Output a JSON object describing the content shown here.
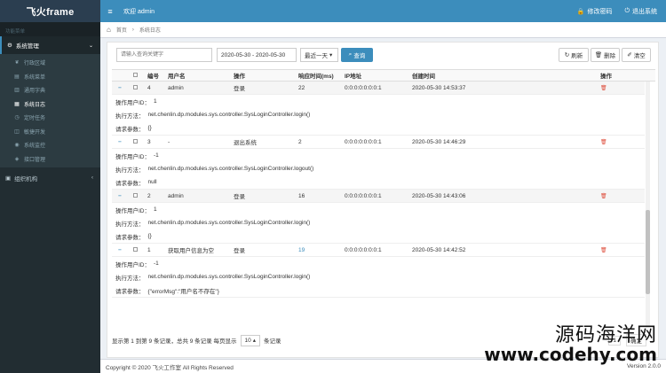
{
  "app": {
    "logo": "飞火frame",
    "welcome": "欢迎 admin",
    "change_password": "修改密码",
    "logout": "退出系统"
  },
  "sidebar": {
    "header": "功能菜单",
    "group1": "系统管理",
    "items": [
      {
        "label": "行政区域",
        "icon": "leaf-icon"
      },
      {
        "label": "系统菜单",
        "icon": "list-icon"
      },
      {
        "label": "通用字典",
        "icon": "book-icon"
      },
      {
        "label": "系统日志",
        "icon": "log-icon"
      },
      {
        "label": "定时任务",
        "icon": "clock-icon"
      },
      {
        "label": "敏捷开发",
        "icon": "code-icon"
      },
      {
        "label": "系统监控",
        "icon": "monitor-icon"
      },
      {
        "label": "接口管理",
        "icon": "api-icon"
      }
    ],
    "group2": "组织机构"
  },
  "breadcrumb": {
    "home": "首页",
    "current": "系统日志"
  },
  "toolbar": {
    "search_placeholder": "请输入查询关键字",
    "date_range": "2020-05-30 - 2020-05-30",
    "range_select": "最近一天",
    "query": "查询",
    "refresh": "刷新",
    "delete": "删除",
    "clear": "清空"
  },
  "table": {
    "headers": {
      "no": "编号",
      "user": "用户名",
      "op": "操作",
      "rt": "响应时间(ms)",
      "ip": "IP地址",
      "time": "创建时间",
      "action": "操作"
    },
    "detail_labels": {
      "uid": "操作用户ID：",
      "method": "执行方法：",
      "params": "请求参数："
    },
    "rows": [
      {
        "no": "4",
        "user": "admin",
        "op": "登录",
        "rt": "22",
        "ip": "0:0:0:0:0:0:0:1",
        "time": "2020-05-30 14:53:37",
        "uid": "1",
        "method": "net.chenlin.dp.modules.sys.controller.SysLoginController.login()",
        "params": "{}"
      },
      {
        "no": "3",
        "user": "-",
        "op": "退出系统",
        "rt": "2",
        "ip": "0:0:0:0:0:0:0:1",
        "time": "2020-05-30 14:46:29",
        "uid": "-1",
        "method": "net.chenlin.dp.modules.sys.controller.SysLoginController.logout()",
        "params": "null"
      },
      {
        "no": "2",
        "user": "admin",
        "op": "登录",
        "rt": "16",
        "ip": "0:0:0:0:0:0:0:1",
        "time": "2020-05-30 14:43:06",
        "uid": "1",
        "method": "net.chenlin.dp.modules.sys.controller.SysLoginController.login()",
        "params": "{}"
      },
      {
        "no": "1",
        "user": "获取用户信息为空",
        "op": "登录",
        "rt": "19",
        "ip": "0:0:0:0:0:0:0:1",
        "time": "2020-05-30 14:42:52",
        "uid": "-1",
        "method": "net.chenlin.dp.modules.sys.controller.SysLoginController.login()",
        "params": "{\"errorMsg\":\"用户名不存在\"}"
      }
    ]
  },
  "pager": {
    "summary": "显示第 1 到第 9 条记录，总共 9 条记录 每页显示",
    "size": "10",
    "suffix": "条记录",
    "page": "1",
    "confirm": "确定"
  },
  "footer": {
    "copyright": "Copyright © 2020 飞火工作室 All Rights Reserved",
    "version": "Version 2.0.0"
  },
  "watermark": {
    "line1": "源码海洋网",
    "line2": "www.codehy.com"
  }
}
